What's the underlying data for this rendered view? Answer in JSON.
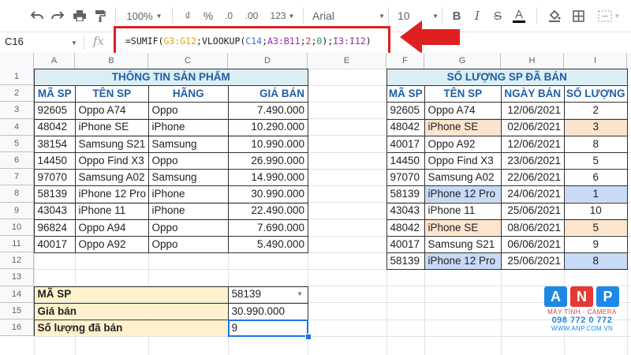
{
  "toolbar": {
    "zoom": "100%",
    "currency": "₫",
    "percent": "%",
    "dec_less": ".0",
    "dec_more": ".00",
    "number_format": "123",
    "font": "Arial",
    "font_size": "10",
    "bold": "B",
    "italic": "I",
    "strike": "S",
    "text_color": "A"
  },
  "formula_bar": {
    "cell_ref": "C16",
    "fx": "fx",
    "formula_parts": [
      {
        "text": "=SUMIF(",
        "cls": ""
      },
      {
        "text": "G3:G12",
        "cls": "g"
      },
      {
        "text": ";VLOOKUP(",
        "cls": ""
      },
      {
        "text": "C14",
        "cls": "b"
      },
      {
        "text": ";",
        "cls": ""
      },
      {
        "text": "A3:B11",
        "cls": "p"
      },
      {
        "text": ";",
        "cls": ""
      },
      {
        "text": "2",
        "cls": "r"
      },
      {
        "text": ";",
        "cls": ""
      },
      {
        "text": "0",
        "cls": "t"
      },
      {
        "text": ");",
        "cls": ""
      },
      {
        "text": "I3:I12",
        "cls": "p"
      },
      {
        "text": ")",
        "cls": ""
      }
    ]
  },
  "columns": [
    "A",
    "B",
    "C",
    "D",
    "E",
    "F",
    "G",
    "H",
    "I"
  ],
  "rows": [
    "1",
    "2",
    "3",
    "4",
    "5",
    "6",
    "7",
    "8",
    "9",
    "10",
    "11",
    "12",
    "13",
    "14",
    "15",
    "16"
  ],
  "left_table": {
    "title": "THÔNG TIN SẢN PHẨM",
    "headers": [
      "MÃ SP",
      "TÊN SP",
      "HÃNG",
      "GIÁ BÁN"
    ],
    "rows": [
      [
        "92605",
        "Oppo A74",
        "Oppo",
        "7.490.000"
      ],
      [
        "48042",
        "iPhone SE",
        "iPhone",
        "10.290.000"
      ],
      [
        "38154",
        "Samsung S21",
        "Samsung",
        "10.990.000"
      ],
      [
        "14450",
        "Oppo Find X3",
        "Oppo",
        "26.990.000"
      ],
      [
        "97070",
        "Samsung A02",
        "Samsung",
        "14.990.000"
      ],
      [
        "58139",
        "iPhone 12 Pro",
        "iPhone",
        "30.990.000"
      ],
      [
        "43043",
        "iPhone 11",
        "iPhone",
        "22.490.000"
      ],
      [
        "96824",
        "Oppo A94",
        "Oppo",
        "7.690.000"
      ],
      [
        "40017",
        "Oppo A92",
        "Oppo",
        "5.490.000"
      ]
    ]
  },
  "right_table": {
    "title": "SỐ LƯỢNG SP ĐÃ BÁN",
    "headers": [
      "MÃ SP",
      "TÊN SP",
      "NGÀY BÁN",
      "SỐ LƯỢNG"
    ],
    "rows": [
      {
        "cells": [
          "92605",
          "Oppo A74",
          "12/06/2021",
          "2"
        ],
        "hl": ""
      },
      {
        "cells": [
          "48042",
          "iPhone SE",
          "02/06/2021",
          "3"
        ],
        "hl": "orange"
      },
      {
        "cells": [
          "40017",
          "Oppo A92",
          "12/06/2021",
          "8"
        ],
        "hl": ""
      },
      {
        "cells": [
          "14450",
          "Oppo Find X3",
          "23/06/2021",
          "5"
        ],
        "hl": ""
      },
      {
        "cells": [
          "97070",
          "Samsung A02",
          "22/06/2021",
          "6"
        ],
        "hl": ""
      },
      {
        "cells": [
          "58139",
          "iPhone 12 Pro",
          "24/06/2021",
          "1"
        ],
        "hl": "blue"
      },
      {
        "cells": [
          "43043",
          "iPhone 11",
          "25/06/2021",
          "10"
        ],
        "hl": ""
      },
      {
        "cells": [
          "48042",
          "iPhone SE",
          "08/06/2021",
          "5"
        ],
        "hl": "orange"
      },
      {
        "cells": [
          "40017",
          "Samsung S21",
          "06/06/2021",
          "9"
        ],
        "hl": ""
      },
      {
        "cells": [
          "58139",
          "iPhone 12 Pro",
          "25/06/2021",
          "8"
        ],
        "hl": "blue"
      }
    ]
  },
  "lookup": {
    "labels": [
      "MÃ SP",
      "Giá bán",
      "Số lượng đã bán"
    ],
    "values": [
      "58139",
      "30.990.000",
      "9"
    ]
  },
  "colors": {
    "title_bg": "#dbeef3",
    "label_bg": "#fff2cc",
    "orange_bg": "#fce5cd",
    "blue_bg": "#c9daf8",
    "header_text": "#1f5fa8",
    "accent_red": "#e02020"
  },
  "logo": {
    "letters": [
      "A",
      "N",
      "P"
    ],
    "tagline": "MÁY TÍNH - CAMERA",
    "phone": "098 772 0 772",
    "site": "WWW.ANP.COM.VN"
  }
}
